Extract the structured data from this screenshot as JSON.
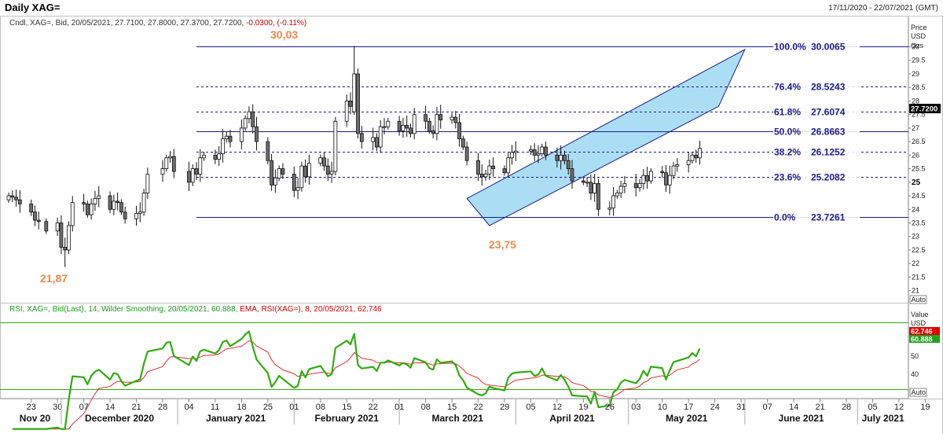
{
  "window": {
    "title": "Daily XAG=",
    "date_range": "17/11/2020 - 22/07/2021 (GMT)"
  },
  "main_info": {
    "label": "Cndl, XAG=, Bid, 20/05/2021, 27.7100, 27.8000, 27.3700, 27.7200,",
    "change": "-0.0300, (-0.11%)"
  },
  "rsi_info": {
    "label_a": "RSI, XAG=, Bid(Last), 14, Wilder Smoothing, 20/05/2021, 60.888,",
    "label_b": "EMA, RSI(XAG=), 8, 20/05/2021, 62.746"
  },
  "price_axis": {
    "header": [
      "Price",
      "USD",
      "Ozs"
    ],
    "ticks": [
      "30",
      "29.5",
      "29",
      "28.5",
      "28",
      "27.5",
      "27",
      "26.5",
      "26",
      "25.5",
      "25",
      "24.5",
      "24",
      "23.5",
      "23",
      "22.5",
      "22",
      "21.5",
      "21"
    ],
    "bold_tick": "25",
    "last_price": "27.7200",
    "auto_label": "Auto"
  },
  "rsi_axis": {
    "header": [
      "Value",
      "USD"
    ],
    "ticks": [
      "50",
      "40"
    ],
    "ema_last": "62.746",
    "rsi_last": "60.888",
    "auto_label": "Auto"
  },
  "colors": {
    "bull_candle": "#ffffff",
    "bear_candle": "#6d6d6d",
    "channel_fill": "#8fd3f0",
    "fib_line": "#1c1c8c",
    "annotation": "#f0884a",
    "rsi_line": "#33aa11",
    "ema_line": "#e03030"
  },
  "annotations": [
    "30,03",
    "21,87",
    "23,75"
  ],
  "x_axis": {
    "days": [
      "23",
      "30",
      "07",
      "14",
      "21",
      "28",
      "04",
      "11",
      "18",
      "25",
      "01",
      "08",
      "15",
      "22",
      "01",
      "08",
      "15",
      "22",
      "29",
      "05",
      "12",
      "19",
      "26",
      "03",
      "10",
      "17",
      "24",
      "31",
      "07",
      "14",
      "21",
      "28",
      "05",
      "12",
      "19"
    ],
    "months": [
      "Nov 20",
      "December 2020",
      "January 2021",
      "February 2021",
      "March 2021",
      "April 2021",
      "May 2021",
      "June 2021",
      "July 2021"
    ]
  },
  "chart_data": {
    "type": "candlestick",
    "title": "Daily XAG=",
    "ylabel": "Price USD Ozs",
    "ylim": [
      20.8,
      30.6
    ],
    "fibonacci": [
      {
        "label": "100.0%",
        "value": "30.0065"
      },
      {
        "label": "76.4%",
        "value": "28.5243"
      },
      {
        "label": "61.8%",
        "value": "27.6074"
      },
      {
        "label": "50.0%",
        "value": "26.8663"
      },
      {
        "label": "38.2%",
        "value": "26.1252"
      },
      {
        "label": "23.6%",
        "value": "25.2082"
      },
      {
        "label": "0.0%",
        "value": "23.7261"
      }
    ],
    "fib_numeric": [
      30.0065,
      28.5243,
      27.6074,
      26.8663,
      26.1252,
      25.2082,
      23.7261
    ],
    "channel": {
      "lower_start": {
        "date": "2021-03-25",
        "price": 23.4
      },
      "lower_end": {
        "date": "2021-05-25",
        "price": 27.8
      },
      "upper_start": {
        "date": "2021-03-19",
        "price": 24.4
      },
      "upper_end": {
        "date": "2021-06-01",
        "price": 29.9
      }
    },
    "closes": [
      24.5,
      24.45,
      24.35,
      24.2,
      23.9,
      23.6,
      23.55,
      23.2,
      23.5,
      22.6,
      22.5,
      23.4,
      24.25,
      24.2,
      23.8,
      24.2,
      24.4,
      24.5,
      24.0,
      24.3,
      24.25,
      23.9,
      23.65,
      23.85,
      23.9,
      24.6,
      25.3,
      25.5,
      25.9,
      25.95,
      25.4,
      25.0,
      25.5,
      25.3,
      25.9,
      26.0,
      25.85,
      26.05,
      26.6,
      26.7,
      26.5,
      27.0,
      27.35,
      27.6,
      27.05,
      26.5,
      25.8,
      24.9,
      25.15,
      25.5,
      25.3,
      24.7,
      24.8,
      25.6,
      25.2,
      25.7,
      25.9,
      25.6,
      25.3,
      25.4,
      27.25,
      28.0,
      27.8,
      29.0,
      26.8,
      26.5,
      26.65,
      26.3,
      27.05,
      27.05,
      27.25,
      26.9,
      27.1,
      27.0,
      26.8,
      27.5,
      27.25,
      26.9,
      26.8,
      27.5,
      27.3,
      27.4,
      27.2,
      26.6,
      26.3,
      25.8,
      25.3,
      25.2,
      25.3,
      25.6,
      25.5,
      25.35,
      25.9,
      26.1,
      26.15,
      26.2,
      26.0,
      26.05,
      26.3,
      26.0,
      25.8,
      26.0,
      25.8,
      25.5,
      25.05,
      25.0,
      25.0,
      24.6,
      24.95,
      24.0,
      24.05,
      24.5,
      24.6,
      24.85,
      24.95,
      24.8,
      24.95,
      25.25,
      25.05,
      25.4,
      25.35,
      24.9,
      25.25,
      25.6,
      25.65,
      25.8,
      26.0,
      25.9,
      26.25,
      26.6,
      26.0,
      26.15,
      26.1,
      26.3,
      26.5,
      25.9,
      25.8,
      26.35,
      26.85,
      26.5,
      27.35,
      27.55,
      27.1,
      27.5,
      27.25,
      26.95,
      27.1,
      27.25,
      27.6,
      28.3,
      27.73,
      27.7,
      27.72
    ]
  }
}
